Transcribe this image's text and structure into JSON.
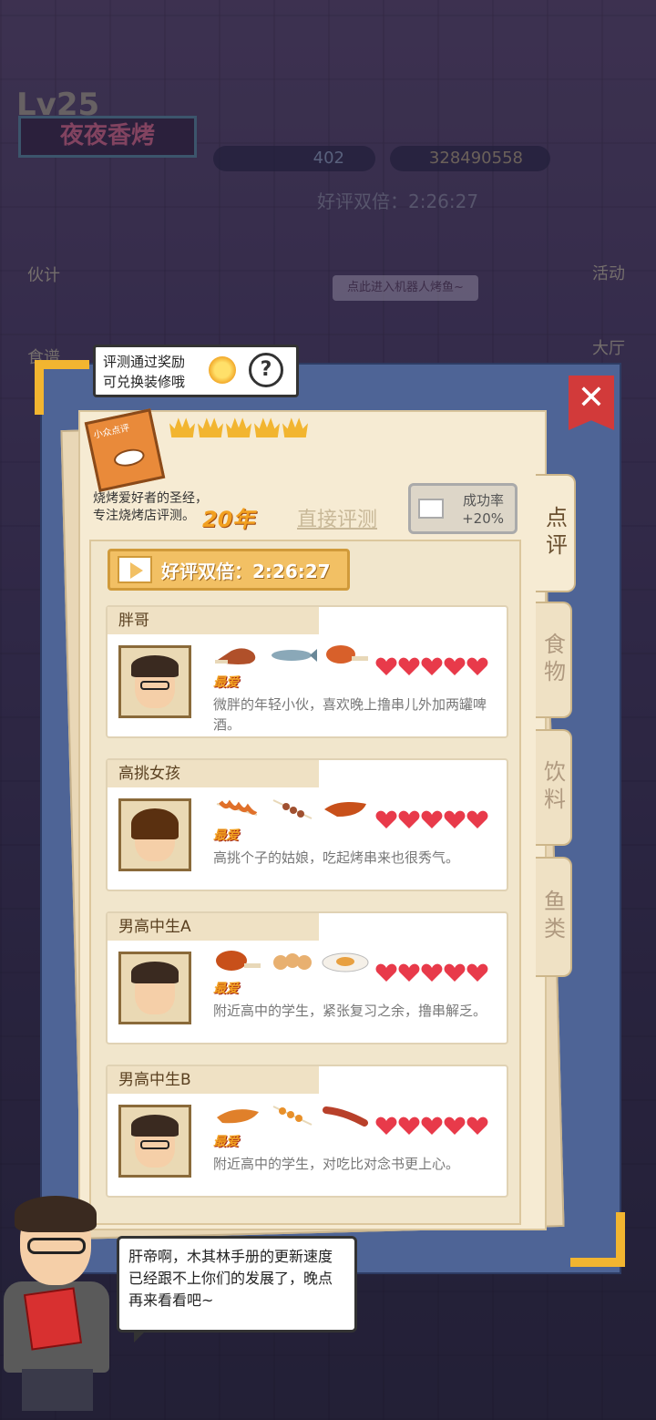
{
  "hud": {
    "level": "Lv25",
    "shop_name": "夜夜香烤",
    "gems": "402",
    "coins": "328490558",
    "double_timer": "好评双倍：2:26:27",
    "left_menu": [
      "伙计",
      "食谱"
    ],
    "right_menu": [
      "活动",
      "大厅"
    ],
    "robot_hint": "点此进入机器人烤鱼~"
  },
  "tooltip": {
    "line1": "评测通过奖励",
    "line2": "可兑换装修哦",
    "help": "?"
  },
  "close_label": "✕",
  "review_book": {
    "book_title": "小众点评",
    "crowns": 5,
    "desc_line1": "烧烤爱好者的圣经，",
    "desc_line2": "专注烧烤店评测。",
    "years": "20年",
    "direct_review": "直接评测",
    "success_rate_label": "成功率",
    "success_rate_value": "+20%"
  },
  "tabs": [
    {
      "label": "点评",
      "active": true
    },
    {
      "label": "食物",
      "active": false
    },
    {
      "label": "饮料",
      "active": false
    },
    {
      "label": "鱼类",
      "active": false
    }
  ],
  "double_banner": "好评双倍：2:26:27",
  "favorite_label": "最爱",
  "customers": [
    {
      "name": "胖哥",
      "hearts": 5,
      "desc": "微胖的年轻小伙，喜欢晚上撸串儿外加两罐啤酒。",
      "glasses": true
    },
    {
      "name": "高挑女孩",
      "hearts": 5,
      "desc": "高挑个子的姑娘，吃起烤串来也很秀气。",
      "glasses": false
    },
    {
      "name": "男高中生A",
      "hearts": 5,
      "desc": "附近高中的学生，紧张复习之余，撸串解乏。",
      "glasses": false
    },
    {
      "name": "男高中生B",
      "hearts": 5,
      "desc": "附近高中的学生，对吃比对念书更上心。",
      "glasses": true
    }
  ],
  "dialog": "肝帝啊，木其林手册的更新速度已经跟不上你们的发展了，晚点再来看看吧~",
  "colors": {
    "panel": "#4e6496",
    "paper": "#f6ebd3",
    "accent": "#f2b530",
    "heart": "#e83a4a",
    "close": "#d23a3a"
  }
}
